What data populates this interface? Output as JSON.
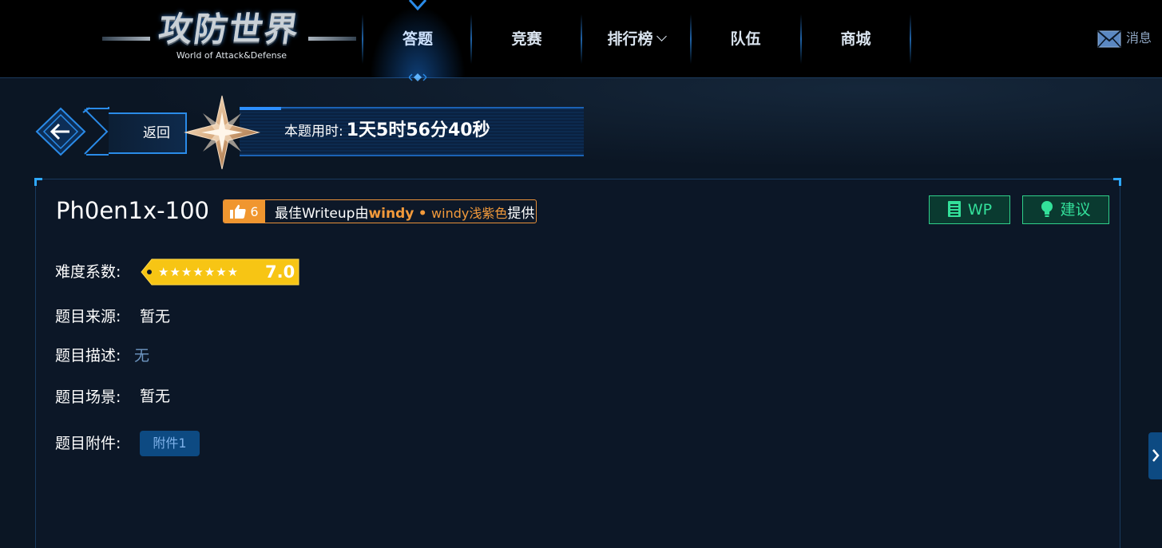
{
  "logo": {
    "title": "攻防世界",
    "subtitle": "World of Attack&Defense"
  },
  "nav": {
    "items": [
      {
        "label": "答题",
        "active": true
      },
      {
        "label": "竞赛"
      },
      {
        "label": "排行榜",
        "dropdown": true
      },
      {
        "label": "队伍"
      },
      {
        "label": "商城"
      }
    ],
    "messages": {
      "label": "消息",
      "icon": "envelope-icon"
    }
  },
  "back": {
    "label": "返回",
    "icon": "arrow-left-icon"
  },
  "timer": {
    "label": "本题用时:",
    "value": "1天5时56分40秒",
    "icon": "star-icon"
  },
  "challenge": {
    "title": "Ph0en1x-100",
    "likes": "6",
    "writeup": {
      "prefix": "最佳Writeup由",
      "author": "windy",
      "separator": "•",
      "team": "windy浅紫色",
      "suffix": "提供"
    },
    "buttons": {
      "wp": "WP",
      "suggest": "建议"
    },
    "difficulty": {
      "label": "难度系数:",
      "stars": "★★★★★★★",
      "value": "7.0"
    },
    "source": {
      "label": "题目来源:",
      "value": "暂无"
    },
    "description": {
      "label": "题目描述:",
      "value": "无"
    },
    "scene": {
      "label": "题目场景:",
      "value": "暂无"
    },
    "attachments": {
      "label": "题目附件:",
      "items": [
        "附件1"
      ]
    }
  },
  "colors": {
    "accent_blue": "#2a8be8",
    "badge_orange": "#f0962f",
    "button_green": "#33e09a",
    "rating_yellow": "#f7c514"
  }
}
